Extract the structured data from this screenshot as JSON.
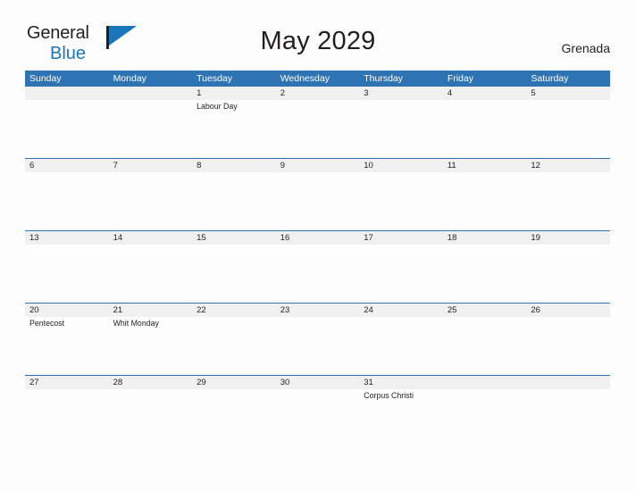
{
  "brand": {
    "name_part1": "General",
    "name_part2": "Blue",
    "flag_icon": "flag-icon",
    "accent_color": "#1b75bb"
  },
  "header": {
    "title": "May 2029",
    "region": "Grenada"
  },
  "calendar": {
    "header_color": "#2e73b3",
    "date_row_color": "#f0f0f0",
    "weekdays": [
      "Sunday",
      "Monday",
      "Tuesday",
      "Wednesday",
      "Thursday",
      "Friday",
      "Saturday"
    ],
    "weeks": [
      {
        "days": [
          {
            "num": "",
            "event": ""
          },
          {
            "num": "",
            "event": ""
          },
          {
            "num": "1",
            "event": "Labour Day"
          },
          {
            "num": "2",
            "event": ""
          },
          {
            "num": "3",
            "event": ""
          },
          {
            "num": "4",
            "event": ""
          },
          {
            "num": "5",
            "event": ""
          }
        ]
      },
      {
        "days": [
          {
            "num": "6",
            "event": ""
          },
          {
            "num": "7",
            "event": ""
          },
          {
            "num": "8",
            "event": ""
          },
          {
            "num": "9",
            "event": ""
          },
          {
            "num": "10",
            "event": ""
          },
          {
            "num": "11",
            "event": ""
          },
          {
            "num": "12",
            "event": ""
          }
        ]
      },
      {
        "days": [
          {
            "num": "13",
            "event": ""
          },
          {
            "num": "14",
            "event": ""
          },
          {
            "num": "15",
            "event": ""
          },
          {
            "num": "16",
            "event": ""
          },
          {
            "num": "17",
            "event": ""
          },
          {
            "num": "18",
            "event": ""
          },
          {
            "num": "19",
            "event": ""
          }
        ]
      },
      {
        "days": [
          {
            "num": "20",
            "event": "Pentecost"
          },
          {
            "num": "21",
            "event": "Whit Monday"
          },
          {
            "num": "22",
            "event": ""
          },
          {
            "num": "23",
            "event": ""
          },
          {
            "num": "24",
            "event": ""
          },
          {
            "num": "25",
            "event": ""
          },
          {
            "num": "26",
            "event": ""
          }
        ]
      },
      {
        "days": [
          {
            "num": "27",
            "event": ""
          },
          {
            "num": "28",
            "event": ""
          },
          {
            "num": "29",
            "event": ""
          },
          {
            "num": "30",
            "event": ""
          },
          {
            "num": "31",
            "event": "Corpus Christi"
          },
          {
            "num": "",
            "event": ""
          },
          {
            "num": "",
            "event": ""
          }
        ]
      }
    ]
  }
}
